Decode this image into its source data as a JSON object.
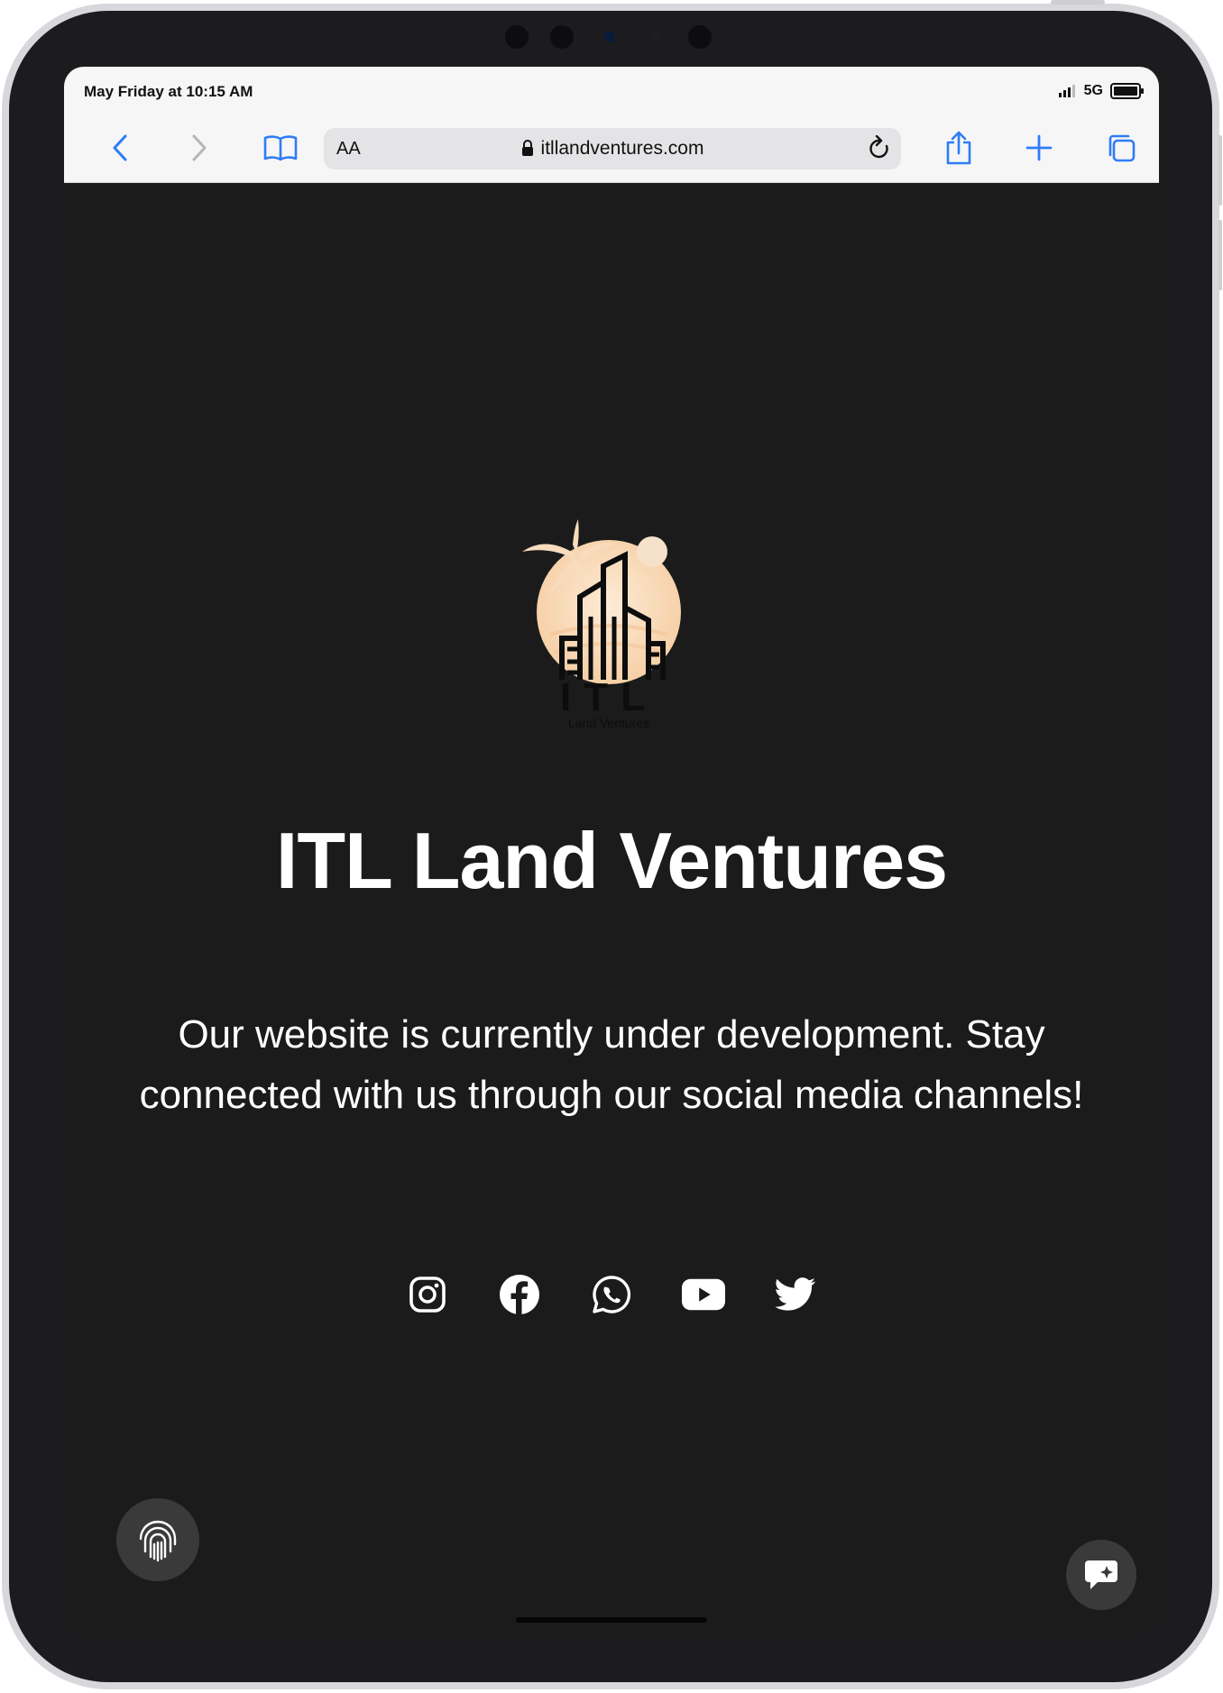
{
  "status_bar": {
    "time": "May Friday at 10:15 AM",
    "network": "5G"
  },
  "browser": {
    "text_size_label": "AA",
    "url": "itllandventures.com"
  },
  "logo": {
    "mark_text": "ITL",
    "mark_subtext": "Land Ventures"
  },
  "page": {
    "title": "ITL Land Ventures",
    "message": "Our website is currently under development. Stay connected with us through our social media channels!"
  },
  "socials": [
    "instagram-icon",
    "facebook-icon",
    "whatsapp-icon",
    "youtube-icon",
    "twitter-icon"
  ],
  "colors": {
    "accent": "#2f7cf6",
    "page_background": "#1b1b1b",
    "logo_sun": "#fbe0c3"
  }
}
